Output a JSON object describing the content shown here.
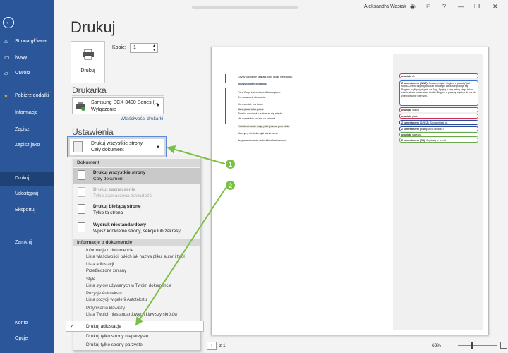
{
  "topbar": {
    "user_name": "Aleksandra Wasiak"
  },
  "sidebar": {
    "items": [
      {
        "label": "Strona główna",
        "icon": "home-icon"
      },
      {
        "label": "Nowy",
        "icon": "new-document-icon"
      },
      {
        "label": "Otwórz",
        "icon": "folder-icon"
      },
      {
        "label": "Pobierz dodatki",
        "icon": "star-icon"
      },
      {
        "label": "Informacje"
      },
      {
        "label": "Zapisz"
      },
      {
        "label": "Zapisz jako"
      },
      {
        "label": "Drukuj"
      },
      {
        "label": "Udostępnij"
      },
      {
        "label": "Eksportuj"
      },
      {
        "label": "Zamknij"
      },
      {
        "label": "Konto"
      },
      {
        "label": "Opcje"
      }
    ]
  },
  "print": {
    "title": "Drukuj",
    "button_label": "Drukuj",
    "copies_label": "Kopie:",
    "copies_value": "1"
  },
  "printer": {
    "section": "Drukarka",
    "name": "Samsung SCX-3400 Series (...",
    "status": "Wyłączenie",
    "properties_link": "Właściwości drukarki"
  },
  "settings": {
    "section": "Ustawienia",
    "selected_line1": "Drukuj wszystkie strony",
    "selected_line2": "Cały dokument"
  },
  "dropdown": {
    "header_document": "Dokument",
    "options": [
      {
        "title": "Drukuj wszystkie strony",
        "sub": "Cały dokument"
      },
      {
        "title": "Drukuj zaznaczenie",
        "sub": "Tylko zaznaczona zawartość"
      },
      {
        "title": "Drukuj bieżącą stronę",
        "sub": "Tylko ta strona"
      },
      {
        "title": "Wydruk niestandardowy",
        "sub": "Wpisz konkretne strony, sekcje lub zakresy"
      }
    ],
    "header_info": "Informacje o dokumencie",
    "info_items": [
      "Informacje o dokumencie",
      "Lista właściwości, takich jak nazwa pliku, autor i tytuł",
      "Lista adiustacji",
      "Przeźledzone zmiany",
      "Style",
      "Lista stylów używanych w Twoim dokumencie",
      "Pozycje Autotekstu",
      "Lista pozycji w galerii Autotekstu",
      "Przypisania klawiszy",
      "Lista Twoich niestandardowych klawiszy skrótów"
    ],
    "checked_option": "Drukuj adiustacje",
    "odd_pages": "Drukuj tylko strony nieparzyste",
    "even_pages": "Drukuj tylko strony parzyste"
  },
  "preview": {
    "lines": [
      "Gdyby babka nie skakała, toby wódki nie starała.",
      "Między Bogiem a prawdą.",
      "Panu Bogu świeczka, a diabłu ogarek.",
      "Co ma wisieć, nie utonie.",
      "Kto ma miał, ma kołku.",
      "Taka płaca, taka praca.",
      "Ziarnko do ziarnka, a zbierze się miarka.",
      "Nie ważne kto, ważne co odmówi.",
      "Póki drzwi wody mają, póki jeszcze przy stole.",
      "Maczymy nie była myśl ichnbrowna.",
      "Amy adaptowanie matteriałów Matuszaków."
    ],
    "comments": [
      {
        "author": "usunięto",
        "text": "ab"
      },
      {
        "author": "Z komentarzem (WWT):",
        "text": "Postaw „między Bogiem a prawdą” jest Marku. Źrenic trzymaj zbiorczo wskazuje, ale dostego-Moje się Bogiem, czyli przystępnie na Bogi, Spójną z inną wolną i tego też w czasie słowa podzielanie. Źródło. Bogiem a prawdą, zgadza się na ich zdecydowanie wiernych."
      },
      {
        "author": "usunięto",
        "text": "Stabla"
      },
      {
        "author": "usunięto",
        "text": "plant"
      },
      {
        "author": "Z komentarzem (D, W.Z):",
        "text": "To nawet jest ok."
      },
      {
        "author": "Z komentarzem (z/AIZ):",
        "text": "A co oznacza?"
      },
      {
        "author": "usunięto",
        "text": "nawraca"
      },
      {
        "author": "Z komentarzem (Z/4):",
        "text": "Czyta się te te mili."
      }
    ]
  },
  "statusbar": {
    "page": "1",
    "of": "z 1",
    "zoom": "63%"
  },
  "callouts": {
    "first": "1",
    "second": "2"
  }
}
